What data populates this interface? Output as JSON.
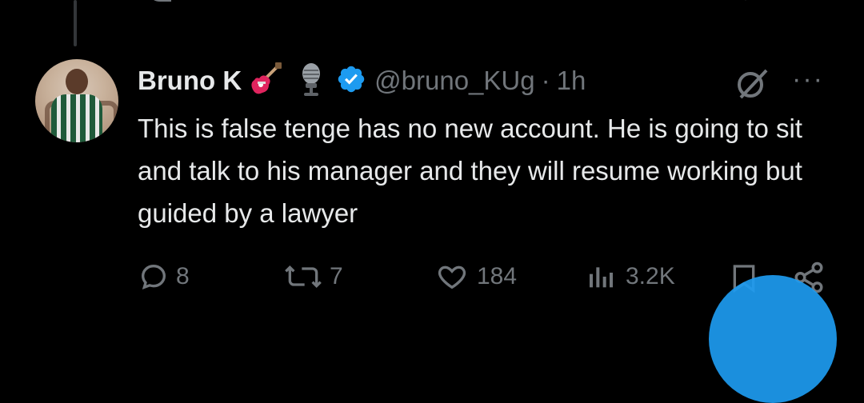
{
  "tweet": {
    "author_name": "Bruno K",
    "handle": "@bruno_KUg",
    "separator": "·",
    "time": "1h",
    "body": "This is false tenge has no new account. He is going to sit and talk to his manager and they will resume working but guided by a lawyer",
    "replies": "8",
    "reposts": "7",
    "likes": "184",
    "views": "3.2K"
  },
  "icons": {
    "emoji1": "guitar-emoji",
    "emoji2": "microphone-emoji",
    "verified": "verified-badge",
    "grok": "grok-icon",
    "more": "more-icon",
    "reply": "reply-icon",
    "repost": "repost-icon",
    "like": "heart-icon",
    "views": "views-icon",
    "bookmark": "bookmark-icon",
    "share": "share-icon"
  },
  "colors": {
    "background": "#000000",
    "text": "#e7e9ea",
    "muted": "#71767b",
    "accent": "#1d9bf0"
  }
}
